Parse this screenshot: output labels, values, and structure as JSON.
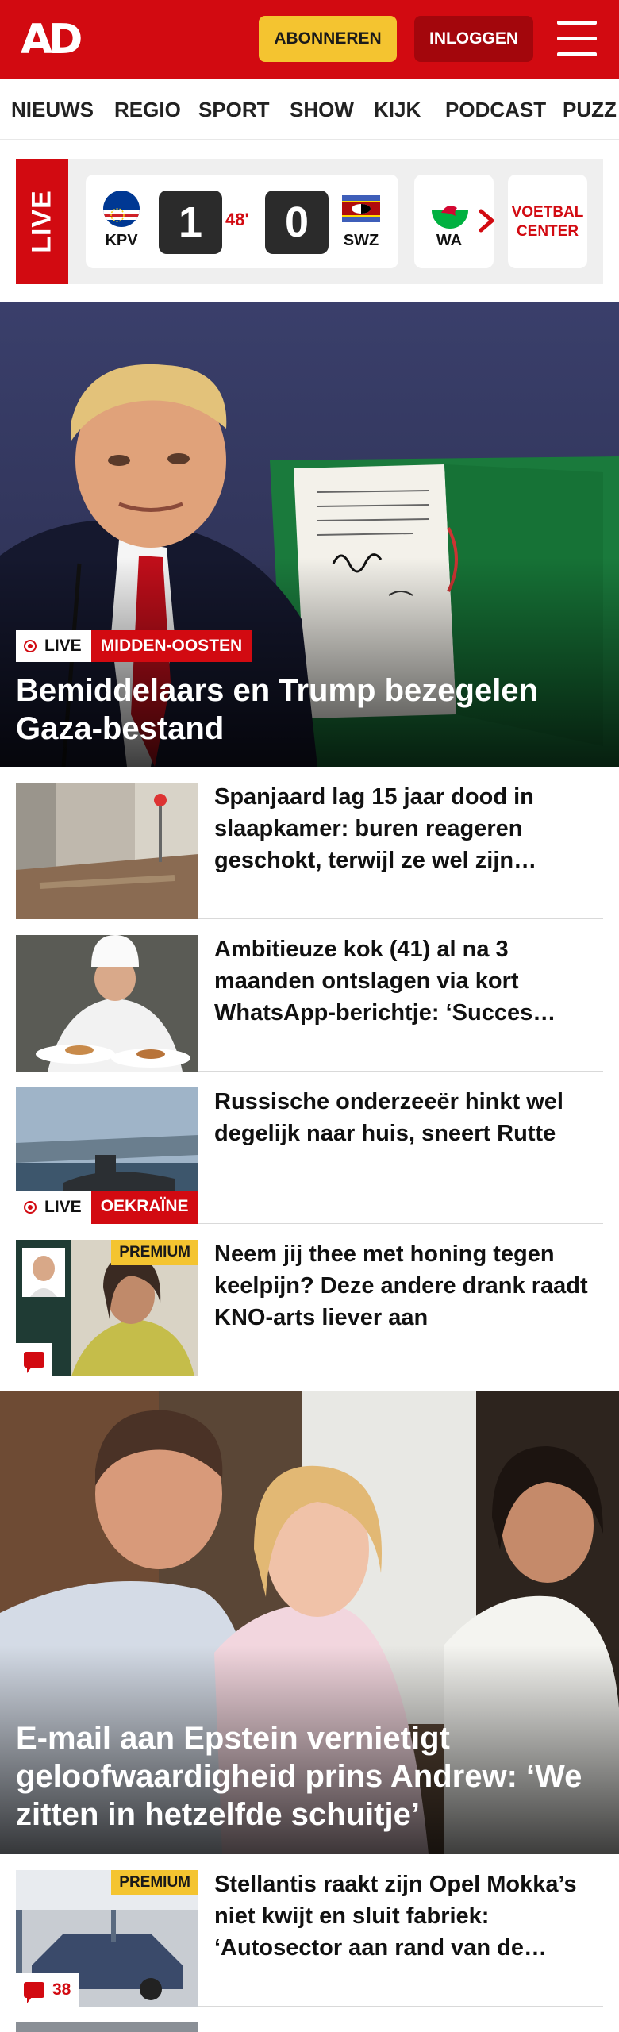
{
  "header": {
    "logo": "AD",
    "subscribe_label": "ABONNEREN",
    "login_label": "INLOGGEN",
    "menu_icon": "hamburger-menu-icon"
  },
  "nav": {
    "items": [
      "NIEUWS",
      "REGIO",
      "SPORT",
      "SHOW",
      "KIJK",
      "PODCAST",
      "PUZZ"
    ]
  },
  "live_scores": {
    "live_label": "LIVE",
    "match": {
      "home_team": "KPV",
      "away_team": "SWZ",
      "home_score": "1",
      "away_score": "0",
      "minute": "48'"
    },
    "next_team_partial": "WA",
    "voetbal_center_label": "VOETBAL CENTER"
  },
  "hero": {
    "live_label": "LIVE",
    "category": "MIDDEN-OOSTEN",
    "title": "Bemiddelaars en Trump bezegelen Gaza-bestand"
  },
  "articles": [
    {
      "title": "Spanjaard lag 15 jaar dood in slaapkamer: buren reageren geschokt, terwijl ze wel zijn geïnformeerd"
    },
    {
      "title": "Ambitieuze kok (41) al na 3 maanden ontslagen via kort WhatsApp-berichtje: ‘Succes ermee’"
    },
    {
      "title": "Russische onderzeeër hinkt wel degelijk naar huis, sneert Rutte",
      "live_label": "LIVE",
      "category": "OEKRAÏNE"
    },
    {
      "title": "Neem jij thee met honing tegen keelpijn? Deze andere drank raadt KNO-arts liever aan",
      "premium_label": "PREMIUM"
    }
  ],
  "hero2": {
    "title": "E-mail aan Epstein vernietigt geloofwaardigheid prins Andrew: ‘We zitten in hetzelfde schuitje’"
  },
  "articles2": [
    {
      "title": "Stellantis raakt zijn Opel Mokka’s niet kwijt en sluit fabriek: ‘Autosector aan rand van de afgrond’",
      "premium_label": "PREMIUM",
      "comments": "38"
    }
  ],
  "colors": {
    "brand_red": "#d20a11",
    "premium_yellow": "#f4c430",
    "login_dark_red": "#a3060c"
  }
}
